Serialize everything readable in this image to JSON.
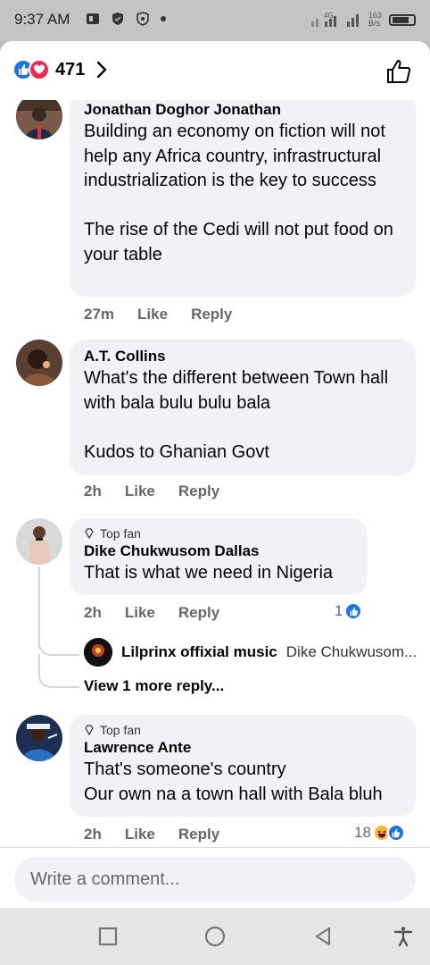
{
  "status": {
    "time": "9:37 AM",
    "network": "4G",
    "speed": "163\nB/s"
  },
  "header": {
    "reaction_count": "471"
  },
  "comments": [
    {
      "author": "Jonathan Doghor Jonathan",
      "text": "Building an economy on fiction will not help any Africa country, infrastructural industrialization is the key to success\n\nThe rise of the Cedi will not put food on your table",
      "time": "27m",
      "like_label": "Like",
      "reply_label": "Reply"
    },
    {
      "author": "A.T. Collins",
      "text": "What's the different between Town hall with bala bulu bulu bala\n\nKudos to Ghanian Govt",
      "time": "2h",
      "like_label": "Like",
      "reply_label": "Reply"
    },
    {
      "badge": "Top fan",
      "author": "Dike Chukwusom Dallas",
      "text": "That is what we need in Nigeria",
      "time": "2h",
      "like_label": "Like",
      "reply_label": "Reply",
      "reactions": "1",
      "reply_preview": {
        "name": "Lilprinx offixial music",
        "snippet": "Dike Chukwusom..."
      },
      "view_more": "View 1 more reply..."
    },
    {
      "badge": "Top fan",
      "author": "Lawrence Ante",
      "text": "That's someone's country\nOur own na a town hall with Bala bluh",
      "time": "2h",
      "like_label": "Like",
      "reply_label": "Reply",
      "reactions": "18"
    }
  ],
  "composer": {
    "placeholder": "Write a comment..."
  },
  "colors": {
    "accent": "#1b74e4",
    "love": "#f0284a",
    "bubble": "#f0f2f5",
    "meta": "#65676b"
  },
  "icons": [
    "like-icon",
    "love-icon",
    "haha-icon",
    "chevron-right-icon",
    "thumbs-up-outline-icon",
    "diamond-icon",
    "square-icon",
    "circle-icon",
    "back-triangle-icon",
    "accessibility-icon"
  ]
}
